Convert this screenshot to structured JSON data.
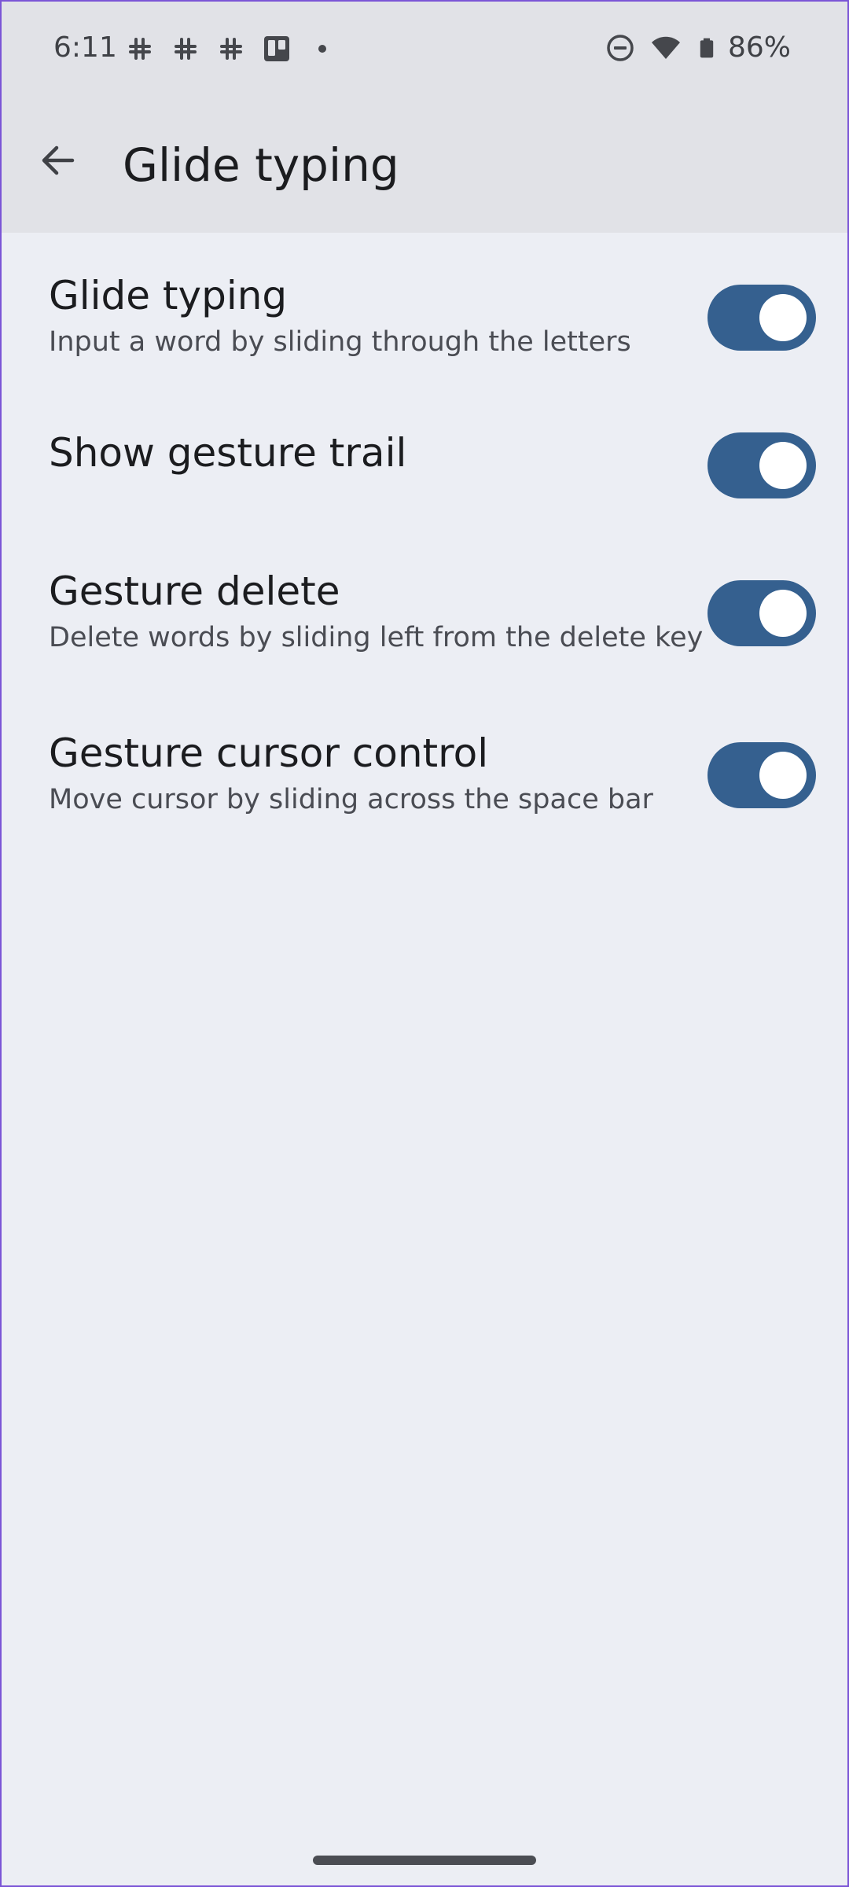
{
  "status_bar": {
    "time": "6:11",
    "left_icons": [
      "slack-icon",
      "slack-icon",
      "slack-icon",
      "trello-icon",
      "dot-icon"
    ],
    "right_icons": [
      "do-not-disturb-icon",
      "wifi-icon",
      "battery-icon"
    ],
    "battery_percent": "86%"
  },
  "app_bar": {
    "back_icon": "arrow-back-icon",
    "title": "Glide typing"
  },
  "settings": [
    {
      "title": "Glide typing",
      "summary": "Input a word by sliding through the letters",
      "enabled": true
    },
    {
      "title": "Show gesture trail",
      "summary": "",
      "enabled": true
    },
    {
      "title": "Gesture delete",
      "summary": "Delete words by sliding left from the delete key",
      "enabled": true
    },
    {
      "title": "Gesture cursor control",
      "summary": "Move cursor by sliding across the space bar",
      "enabled": true
    }
  ],
  "colors": {
    "background": "#eceef4",
    "app_bar_background": "#e1e2e7",
    "toggle_on_track": "#35608f",
    "toggle_knob": "#ffffff"
  }
}
